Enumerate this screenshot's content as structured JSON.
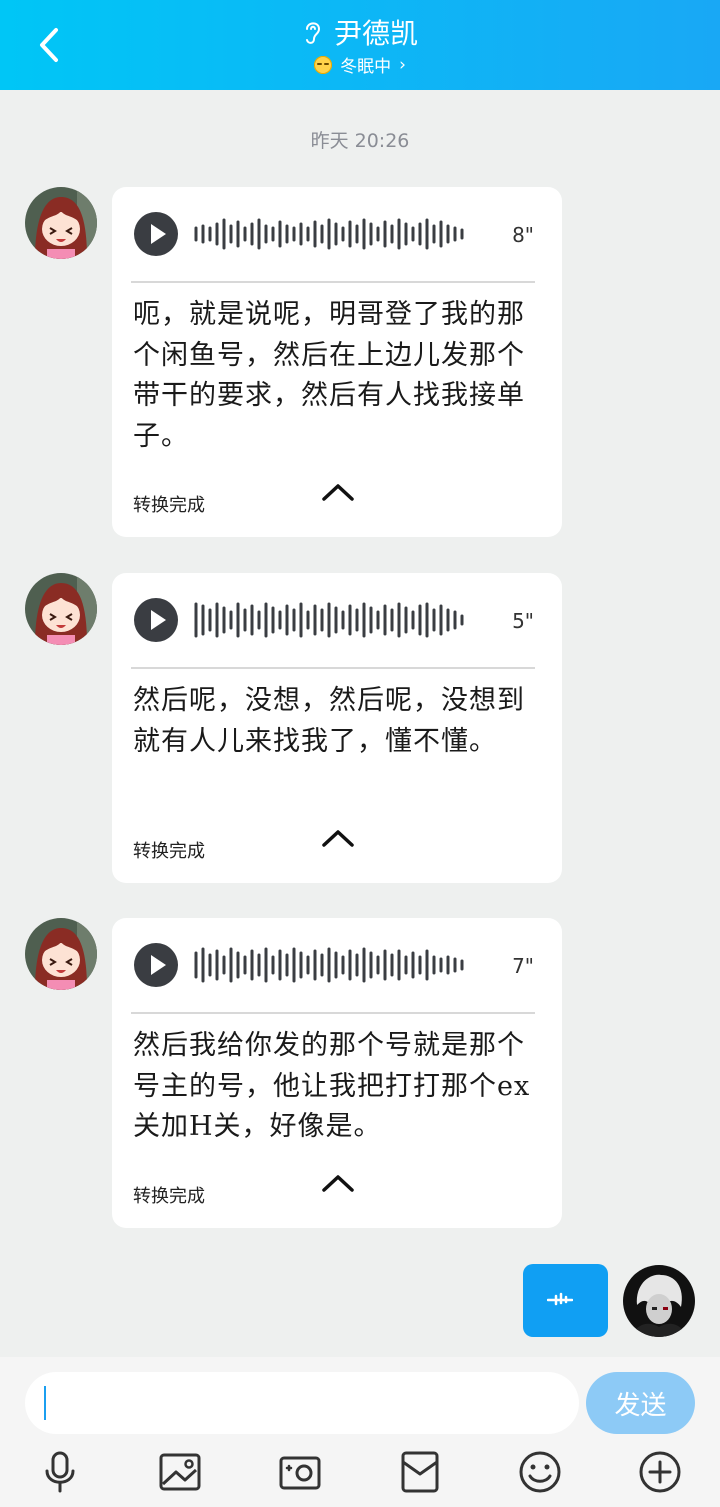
{
  "header": {
    "title": "尹德凯",
    "status": "冬眠中",
    "status_chevron": "›",
    "icons": [
      "back-chevron-icon",
      "ear-icon",
      "sleepy-emoji-icon"
    ]
  },
  "chat": {
    "timestamp": "昨天 20:26",
    "messages": [
      {
        "duration": "8\"",
        "text": "呃，就是说呢，明哥登了我的那个闲鱼号，然后在上边儿发那个带干的要求，然后有人找我接单子。",
        "status": "转换完成"
      },
      {
        "duration": "5\"",
        "text": "然后呢，没想，然后呢，没想到就有人儿来找我了，懂不懂。",
        "status": "转换完成"
      },
      {
        "duration": "7\"",
        "text": "然后我给你发的那个号就是那个号主的号，他让我把打打那个ex关加H关，好像是。",
        "status": "转换完成"
      }
    ]
  },
  "input": {
    "value": "",
    "send_label": "发送"
  },
  "toolbar": {
    "icons": [
      "microphone-icon",
      "image-icon",
      "camera-icon",
      "red-packet-icon",
      "emoji-icon",
      "plus-icon"
    ]
  },
  "colors": {
    "header_start": "#00c6f6",
    "header_end": "#19a8f5",
    "sent_bubble": "#109ff3",
    "send_button": "#8dcaf6"
  }
}
